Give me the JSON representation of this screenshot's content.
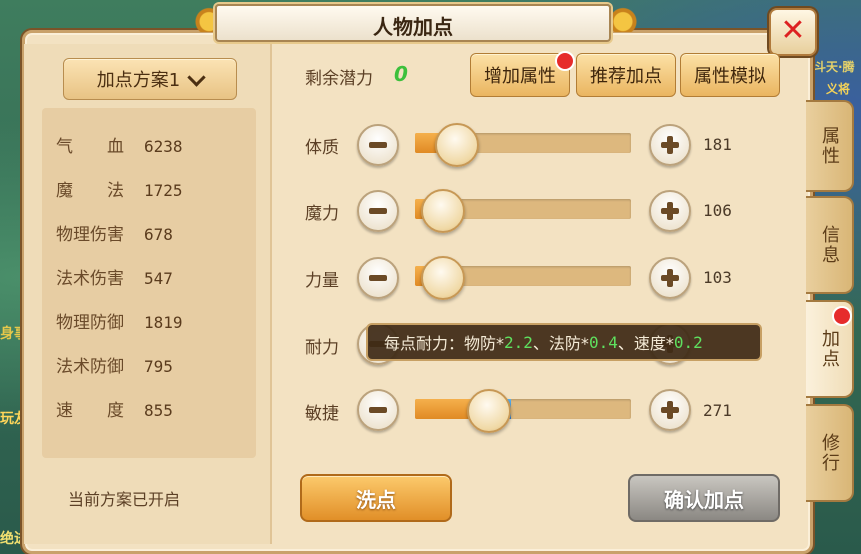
{
  "window": {
    "title": "人物加点"
  },
  "background": {
    "left_texts": [
      "身事",
      "玩友",
      "绝进"
    ],
    "right_texts": [
      "斗天·腾",
      "义将"
    ]
  },
  "scheme": {
    "selected": "加点方案1",
    "status": "当前方案已开启"
  },
  "stats": [
    {
      "label": "气　　血",
      "value": "6238"
    },
    {
      "label": "魔　　法",
      "value": "1725"
    },
    {
      "label": "物理伤害",
      "value": "678"
    },
    {
      "label": "法术伤害",
      "value": "547"
    },
    {
      "label": "物理防御",
      "value": "1819"
    },
    {
      "label": "法术防御",
      "value": "795"
    },
    {
      "label": "速　　度",
      "value": "855"
    }
  ],
  "potential": {
    "label": "剩余潜力",
    "value": "0"
  },
  "top_buttons": {
    "add_attr": "增加属性",
    "recommend": "推荐加点",
    "simulate": "属性模拟"
  },
  "attributes": [
    {
      "label": "体质",
      "value": "181",
      "fraction": 0.11
    },
    {
      "label": "魔力",
      "value": "106",
      "fraction": 0.03
    },
    {
      "label": "力量",
      "value": "103",
      "fraction": 0.03
    },
    {
      "label": "耐力",
      "value": "",
      "fraction": 0.0
    },
    {
      "label": "敏捷",
      "value": "271",
      "fraction": 0.16,
      "added_fraction": 0.12
    }
  ],
  "tooltip": {
    "prefix": "每点耐力：物防*",
    "phys_def": "2.2",
    "sep1": "、法防*",
    "mag_def": "0.4",
    "sep2": "、速度*",
    "speed": "0.2"
  },
  "buttons": {
    "wash": "洗点",
    "confirm": "确认加点"
  },
  "side_tabs": [
    "属性",
    "信息",
    "加点",
    "修行"
  ],
  "colors": {
    "potential_green": "#3cc03c",
    "fill_orange": "#e08a24",
    "fill_blue": "#2a7fd6",
    "badge_red": "#e62b2b"
  }
}
